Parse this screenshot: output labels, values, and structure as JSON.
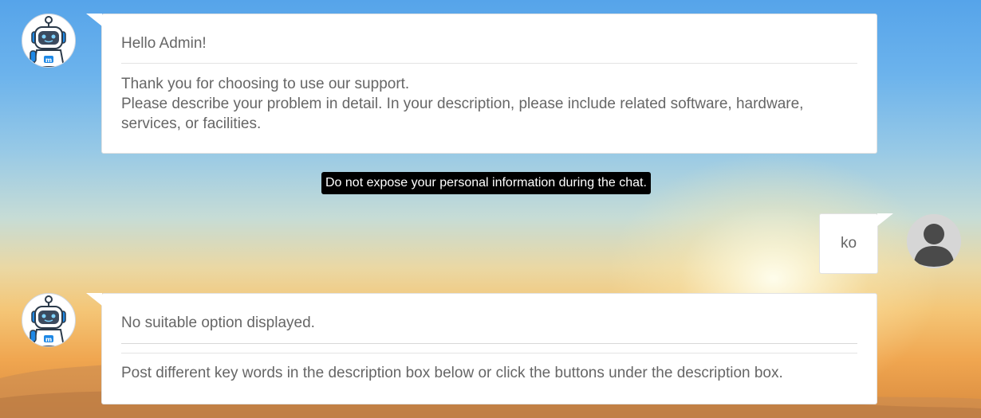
{
  "messages": {
    "welcome": {
      "greeting": "Hello Admin!",
      "line1": "Thank you for choosing to use our support.",
      "line2": "Please describe your problem in detail. In your description, please include related software, hardware, services, or facilities."
    },
    "notice": "Do not expose your personal information during the chat.",
    "user_message": "ko",
    "no_option": {
      "line1": "No suitable option displayed.",
      "line2": "Post different key words in the description box below or click the buttons under the description box."
    }
  },
  "icons": {
    "bot_avatar": "robot-avatar-icon",
    "user_avatar": "user-avatar-icon"
  },
  "colors": {
    "bubble_background": "#ffffff",
    "bubble_text": "#666666",
    "notice_background": "#000000",
    "notice_text": "#ffffff",
    "bot_accent": "#1e88e5"
  }
}
